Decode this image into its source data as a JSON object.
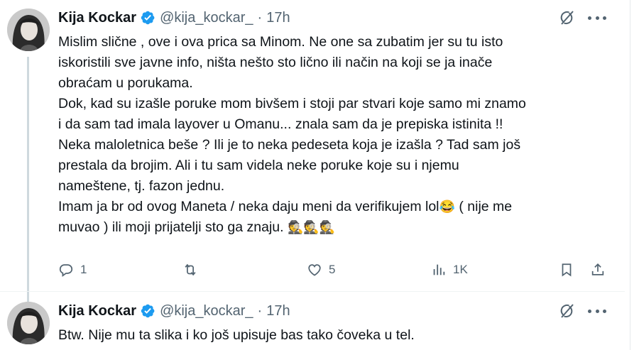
{
  "tweets": [
    {
      "author": {
        "name": "Kija Kockar",
        "handle": "@kija_kockar_",
        "separator": "·",
        "time": "17h"
      },
      "lines": [
        "Mislim slične , ove i ova prica sa Minom. Ne one sa zubatim jer su tu isto",
        "iskoristili sve javne info, ništa nešto sto lično ili način na koji se ja inače",
        "obraćam u porukama.",
        "Dok, kad su izašle poruke mom bivšem i stoji par stvari koje samo mi znamo",
        "i da sam tad imala layover u Omanu... znala sam da je prepiska istinita !!",
        "Neka maloletnica beše ? Ili je to neka pedeseta koja je izašla ? Tad sam još",
        "prestala da brojim. Ali i tu sam videla neke poruke koje su i njemu",
        "nameštene, tj. fazon jednu.",
        "Imam ja br od ovog Maneta / neka daju meni da verifikujem lol",
        "muvao ) ili moji prijatelji sto ga znaju. "
      ],
      "line9_after_emoji": " ( nije me",
      "emoji_laugh": "😂",
      "emoji_detectives": "🕵️🕵️🕵️",
      "actions": {
        "replies": "1",
        "retweets": "",
        "likes": "5",
        "views": "1K"
      }
    },
    {
      "author": {
        "name": "Kija Kockar",
        "handle": "@kija_kockar_",
        "separator": "·",
        "time": "17h"
      },
      "lines": [
        "Btw. Nije mu ta slika i ko još upisuje bas tako čoveka u tel."
      ]
    }
  ],
  "icons": {
    "verified": "verified-badge-icon",
    "grok": "grok-icon",
    "more": "more-icon",
    "reply": "reply-icon",
    "retweet": "retweet-icon",
    "like": "like-icon",
    "views": "views-icon",
    "bookmark": "bookmark-icon",
    "share": "share-icon"
  },
  "colors": {
    "text": "#0f1419",
    "secondary": "#536471",
    "verified": "#1d9bf0",
    "thread_line": "#cfd9de"
  }
}
